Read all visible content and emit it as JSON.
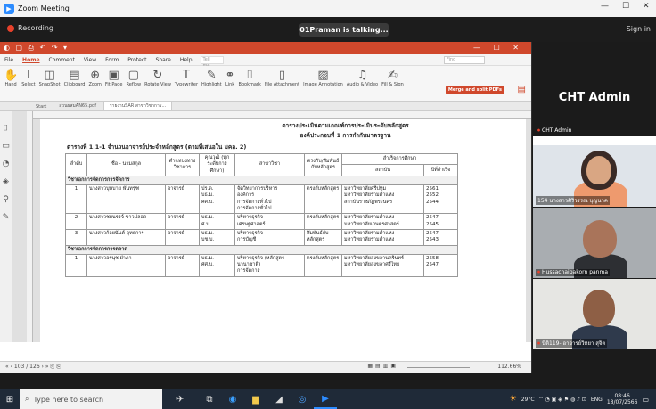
{
  "zoom": {
    "window_title": "Zoom Meeting",
    "recording_label": "Recording",
    "talking_label": "01Praman is talking...",
    "sign_in": "Sign in",
    "window_controls": [
      "—",
      "☐",
      "✕"
    ]
  },
  "foxit": {
    "menu": [
      "File",
      "Home",
      "Comment",
      "View",
      "Form",
      "Protect",
      "Share",
      "Help"
    ],
    "tell_me": "Tell me...",
    "find_placeholder": "Find",
    "ribbon": [
      {
        "label": "Hand",
        "icon": "hand-icon",
        "glyph": "✋"
      },
      {
        "label": "Select",
        "icon": "select-icon",
        "glyph": "I"
      },
      {
        "label": "SnapShot",
        "icon": "snapshot-icon",
        "glyph": "◫"
      },
      {
        "label": "Clipboard",
        "icon": "clipboard-icon",
        "glyph": "▤"
      },
      {
        "label": "Zoom",
        "icon": "zoom-icon",
        "glyph": "⊕"
      },
      {
        "label": "Fit Page",
        "icon": "fit-page-icon",
        "glyph": "▣"
      },
      {
        "label": "Reflow",
        "icon": "reflow-icon",
        "glyph": "▢"
      },
      {
        "label": "Rotate View",
        "icon": "rotate-icon",
        "glyph": "↻"
      },
      {
        "label": "Typewriter",
        "icon": "typewriter-icon",
        "glyph": "T"
      },
      {
        "label": "Highlight",
        "icon": "highlight-icon",
        "glyph": "✎"
      },
      {
        "label": "Link",
        "icon": "link-icon",
        "glyph": "⚭"
      },
      {
        "label": "Bookmark",
        "icon": "bookmark-icon",
        "glyph": "⌷"
      },
      {
        "label": "File Attachment",
        "icon": "attachment-icon",
        "glyph": "▯"
      },
      {
        "label": "Image Annotation",
        "icon": "image-icon",
        "glyph": "▨"
      },
      {
        "label": "Audio & Video",
        "icon": "audio-video-icon",
        "glyph": "♫"
      },
      {
        "label": "Fill & Sign",
        "icon": "sign-icon",
        "glyph": "✍"
      }
    ],
    "merge_button": "Merge and split PDFs",
    "tabs": [
      "Start",
      "ส่วนผสมAN65.pdf",
      "รายงานSAR สาขาวิชาการ..."
    ],
    "doc_header": [
      "ตารางประเมินตามเกณฑ์การประเมินระดับหลักสูตร",
      "องค์ประกอบที่ 1 การกำกับมาตรฐาน"
    ],
    "table_caption": "ตารางที่ 1.1-1 จำนวนอาจารย์ประจำหลักสูตร (ตามที่เสนอใน มคอ. 2)",
    "table_headers": [
      "ลำดับ",
      "ชื่อ - นามสกุล",
      "ตำแหน่งทางวิชาการ",
      "คุณวุฒิ (ทุกระดับการศึกษา)",
      "สาขาวิชา",
      "ตรงกับ/สัมพันธ์กับหลักสูตร",
      "สำเร็จการศึกษา",
      "สถาบัน",
      "ปีที่สำเร็จ"
    ],
    "groups": [
      {
        "name": "วิชาเอกการจัดการการจัดการ",
        "rows": [
          {
            "no": "1",
            "name": "นางสาวบุษบาย พันทรุฑ",
            "pos": "อาจารย์",
            "deg": [
              "ปร.ด.",
              "บธ.ม.",
              "ศศ.บ."
            ],
            "major": [
              "จัดวิทยาการบริหาร",
              "องค์การ",
              "การจัดการทั่วไป",
              "การจัดการทั่วไป"
            ],
            "rel": "ตรงกับหลักสูตร",
            "inst": [
              "มหาวิทยาลัยศรีปทุม",
              "มหาวิทยาลัยรามคำแหง",
              "สถาบันราชภัฏพระนคร"
            ],
            "year": [
              "2561",
              "2552",
              "2544"
            ]
          },
          {
            "no": "2",
            "name": "นางสาวชยนรรจ์ ขาวปลอด",
            "pos": "อาจารย์",
            "deg": [
              "บธ.ม.",
              "ศ.บ."
            ],
            "major": [
              "บริหารธุรกิจ",
              "เศรษฐศาสตร์"
            ],
            "rel": "ตรงกับหลักสูตร",
            "inst": [
              "มหาวิทยาลัยรามคำแหง",
              "มหาวิทยาลัยเกษตรศาสตร์"
            ],
            "year": [
              "2547",
              "2545"
            ]
          },
          {
            "no": "3",
            "name": "นางสาวก้อยนันต์ อุทธการ",
            "pos": "อาจารย์",
            "deg": [
              "บธ.ม.",
              "บช.บ."
            ],
            "major": [
              "บริหารธุรกิจ",
              "การบัญชี"
            ],
            "rel": "สัมพันธ์กับหลักสูตร",
            "inst": [
              "มหาวิทยาลัยรามคำแหง",
              "มหาวิทยาลัยรามคำแหง"
            ],
            "year": [
              "2547",
              "2543"
            ]
          }
        ]
      },
      {
        "name": "วิชาเอกการจัดการการตลาด",
        "rows": [
          {
            "no": "1",
            "name": "นางสาวอรนุช ฝ่าภา",
            "pos": "อาจารย์",
            "deg": [
              "บธ.ม.",
              "ศศ.บ."
            ],
            "major": [
              "บริหารธุรกิจ (หลักสูตร",
              "นานาชาติ)",
              "การจัดการ"
            ],
            "rel": "ตรงกับหลักสูตร",
            "inst": [
              "มหาวิทยาลัยสงขลานครินทร์",
              "มหาวิทยาลัยสงขลาศรีไทย"
            ],
            "year": [
              "2558",
              "2547"
            ]
          }
        ]
      }
    ],
    "status_page": "103 / 126",
    "status_zoom": "112.66%"
  },
  "gallery": {
    "host_name": "CHT Admin",
    "tiles": [
      {
        "label": "CHT Admin"
      },
      {
        "label": "154 นางสาวศิริวรรณ บุญนาค"
      },
      {
        "label": "Hussachaipakorn panma"
      },
      {
        "label": "นิติ119- อาจารย์วิทยา สุจิต"
      }
    ]
  },
  "taskbar": {
    "search_placeholder": "Type here to search",
    "temperature": "29°C",
    "language": "ENG",
    "time": "08:46",
    "date": "18/07/2566"
  }
}
